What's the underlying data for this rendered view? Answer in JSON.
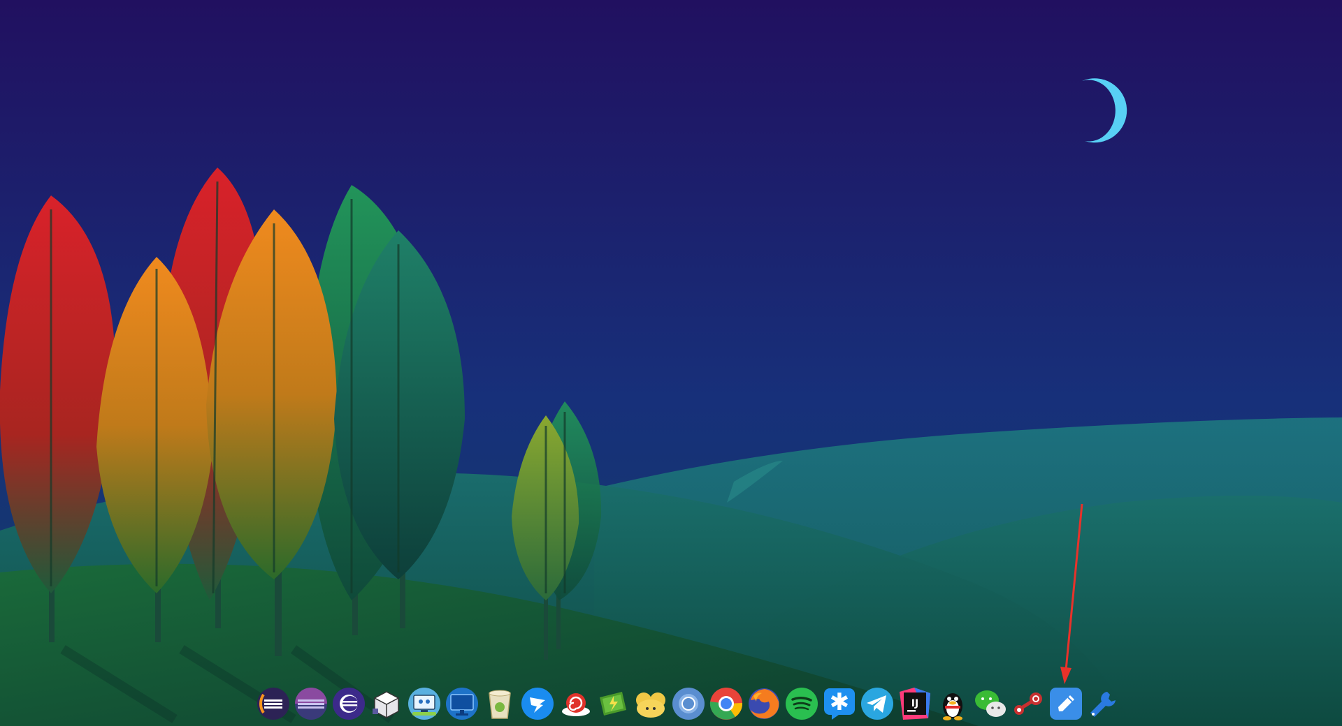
{
  "desktop": {
    "theme_colors": {
      "sky_top": "#211060",
      "sky_bottom": "#142e6a",
      "hill_light": "#1d7a7e",
      "hill_dark": "#0f4a42",
      "moon": "#58d0f5",
      "annotation_arrow": "#e8322a"
    }
  },
  "dock": {
    "items": [
      {
        "name": "eclipse-icon",
        "color": "#2c2255"
      },
      {
        "name": "eclipse-alt-icon",
        "color": "#3a3a7a"
      },
      {
        "name": "eclipse-purple-icon",
        "color": "#3c2a8a"
      },
      {
        "name": "virtualbox-cube-icon",
        "color": "#dddddd"
      },
      {
        "name": "remote-desktop-icon",
        "color": "#5ab0e0"
      },
      {
        "name": "monitor-icon",
        "color": "#1e73c8"
      },
      {
        "name": "trash-can-icon",
        "color": "#e8e0c0"
      },
      {
        "name": "dingtalk-icon",
        "color": "#1a8cf0"
      },
      {
        "name": "snail-icon",
        "color": "#e0322a"
      },
      {
        "name": "battery-tool-icon",
        "color": "#4a9a2a"
      },
      {
        "name": "sheep-clouds-icon",
        "color": "#f0c845"
      },
      {
        "name": "chromium-icon",
        "color": "#5a8ed0"
      },
      {
        "name": "chrome-icon",
        "color": "#e8443a"
      },
      {
        "name": "firefox-icon",
        "color": "#f57c1f"
      },
      {
        "name": "spotify-icon",
        "color": "#2abf50"
      },
      {
        "name": "star-chat-icon",
        "color": "#1e90f0"
      },
      {
        "name": "telegram-icon",
        "color": "#2aa6e0"
      },
      {
        "name": "intellij-icon",
        "color": "#111111"
      },
      {
        "name": "qq-penguin-icon",
        "color": "#111111"
      },
      {
        "name": "wechat-icon",
        "color": "#3abb35"
      },
      {
        "name": "steam-icon",
        "color": "#c83030"
      },
      {
        "name": "text-editor-icon",
        "color": "#3a8ee8"
      },
      {
        "name": "settings-wrench-icon",
        "color": "#2a7ae0"
      }
    ]
  }
}
